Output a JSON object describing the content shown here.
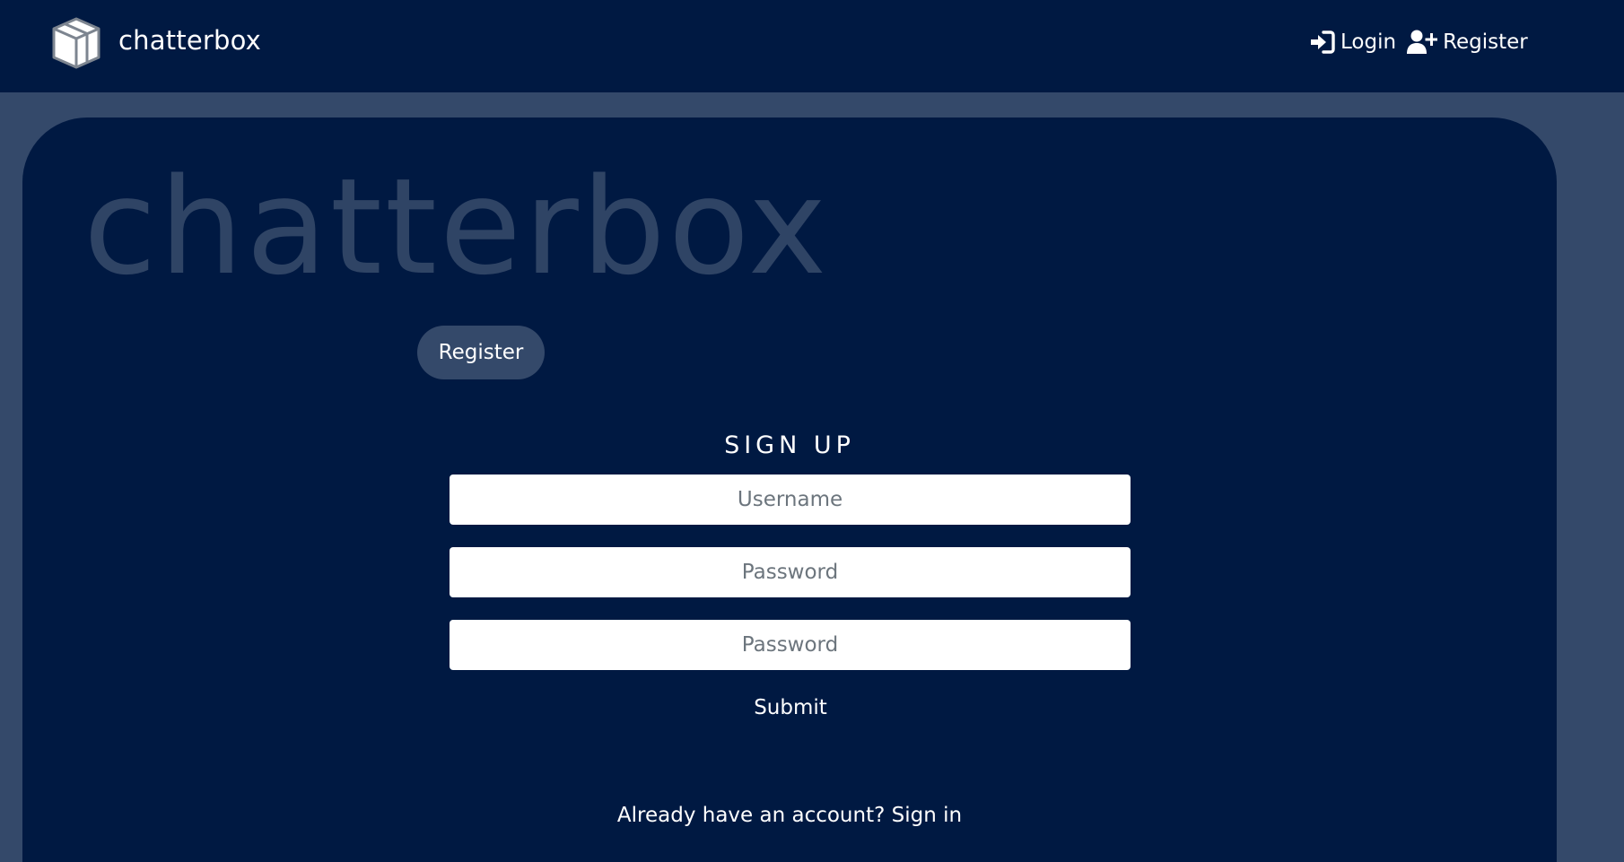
{
  "nav": {
    "brand_name": "chatterbox",
    "brand_icon": "cube-icon",
    "login_label": "Login",
    "login_icon": "sign-in-icon",
    "register_label": "Register",
    "register_icon": "user-plus-icon"
  },
  "hero": {
    "watermark": "chatterbox",
    "register_button": "Register"
  },
  "form": {
    "title": "SIGN UP",
    "username_placeholder": "Username",
    "password_placeholder": "Password",
    "confirm_placeholder": "Password",
    "submit_label": "Submit"
  },
  "footer": {
    "prompt": "Already have an account?",
    "signin_label": "Sign in"
  },
  "colors": {
    "navy": "#001942",
    "slate": "#34496a",
    "watermark": "#2f4465",
    "text": "#ffffff"
  }
}
